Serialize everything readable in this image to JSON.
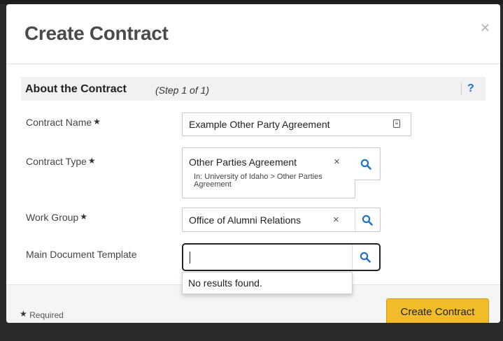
{
  "modal": {
    "title": "Create Contract",
    "close_icon": "close-icon"
  },
  "section": {
    "title": "About the Contract",
    "step": "(Step 1 of 1)",
    "help": "?"
  },
  "fields": {
    "contract_name": {
      "label": "Contract Name",
      "required_mark": "★",
      "value": "Example Other Party Agreement",
      "icon": "document-icon"
    },
    "contract_type": {
      "label": "Contract Type",
      "required_mark": "★",
      "value": "Other Parties Agreement",
      "path": "In: University of Idaho > Other Parties Agreement",
      "clear": "×",
      "icon": "search-icon"
    },
    "work_group": {
      "label": "Work Group",
      "required_mark": "★",
      "value": "Office of Alumni Relations",
      "clear": "×",
      "icon": "search-icon"
    },
    "main_document_template": {
      "label": "Main Document Template",
      "value": "",
      "icon": "search-icon",
      "dropdown_text": "No results found."
    }
  },
  "footer": {
    "required_mark": "★",
    "required_label": "Required",
    "create_button": "Create Contract"
  },
  "colors": {
    "accent_button": "#f2bb2a",
    "search_icon": "#1f73c6",
    "title_text": "#4a4a4a"
  }
}
